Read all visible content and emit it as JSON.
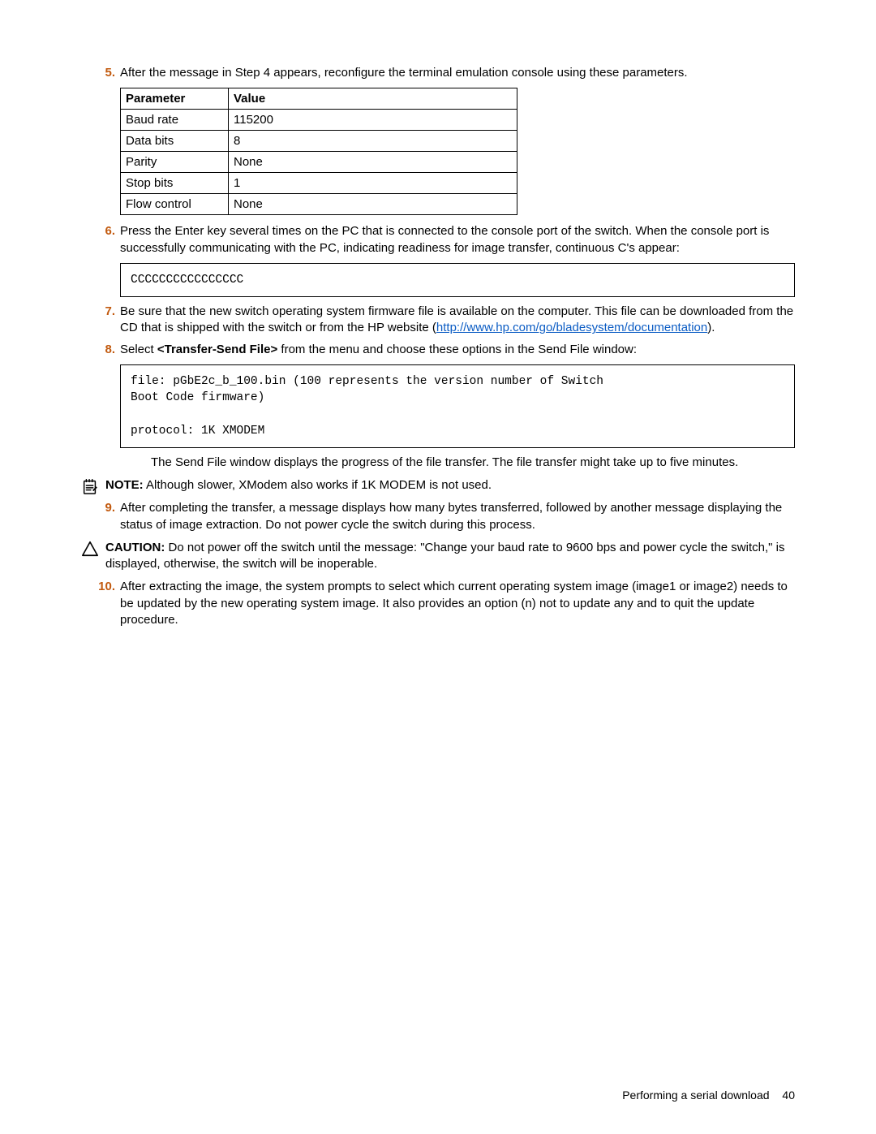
{
  "steps": {
    "s5": {
      "num": "5.",
      "text": "After the message in Step 4 appears, reconfigure the terminal emulation console using these parameters."
    },
    "s6": {
      "num": "6.",
      "text": "Press the Enter key several times on the PC that is connected to the console port of the switch. When the console port is successfully communicating with the PC, indicating readiness for image transfer, continuous C's appear:"
    },
    "s7": {
      "num": "7.",
      "text_before": "Be sure that the new switch operating system firmware file is available on the computer. This file can be downloaded from the CD that is shipped with the switch or from the HP website (",
      "link": "http://www.hp.com/go/bladesystem/documentation",
      "text_after": ")."
    },
    "s8": {
      "num": "8.",
      "text_before": "Select ",
      "bold": "<Transfer-Send File>",
      "text_after": " from the menu and choose these options in the Send File window:"
    },
    "s8_after": {
      "text": "The Send File window displays the progress of the file transfer. The file transfer might take up to five minutes."
    },
    "s9": {
      "num": "9.",
      "text": "After completing the transfer, a message displays how many bytes transferred, followed by another message displaying the status of image extraction. Do not power cycle the switch during this process."
    },
    "s10": {
      "num": "10.",
      "text": "After extracting the image, the system prompts to select which current operating system image (image1 or image2) needs to be updated by the new operating system image. It also provides an option (n) not to update any and to quit the update procedure."
    }
  },
  "table": {
    "headers": {
      "param": "Parameter",
      "value": "Value"
    },
    "rows": [
      {
        "param": "Baud rate",
        "value": "115200"
      },
      {
        "param": "Data bits",
        "value": "8"
      },
      {
        "param": "Parity",
        "value": "None"
      },
      {
        "param": "Stop bits",
        "value": "1"
      },
      {
        "param": "Flow control",
        "value": "None"
      }
    ]
  },
  "code": {
    "cs": "CCCCCCCCCCCCCCCC",
    "sendfile": "file: pGbE2c_b_100.bin (100 represents the version number of Switch\nBoot Code firmware)\n\nprotocol: 1K XMODEM"
  },
  "note": {
    "label": "NOTE:",
    "text": "  Although slower, XModem also works if 1K MODEM is not used."
  },
  "caution": {
    "label": "CAUTION:",
    "text": "  Do not power off the switch until the message: \"Change your baud rate to 9600 bps and power cycle the switch,\" is displayed, otherwise, the switch will be inoperable."
  },
  "footer": {
    "text": "Performing a serial download",
    "page": "40"
  }
}
